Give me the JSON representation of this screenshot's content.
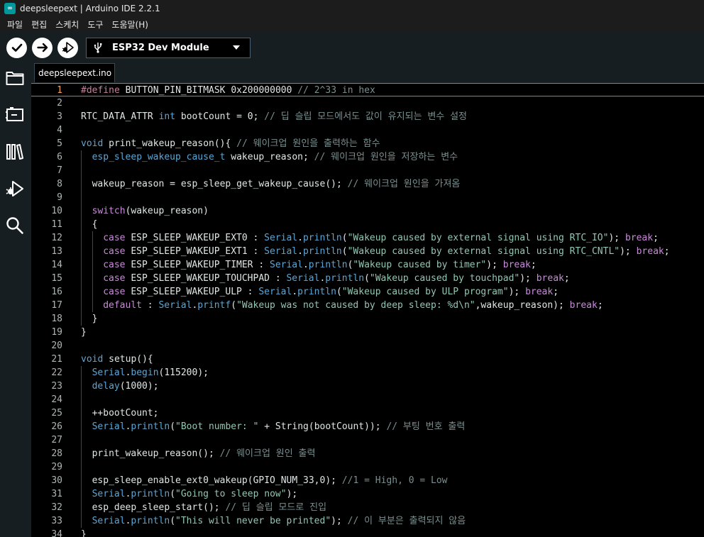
{
  "window": {
    "title": "deepsleepext | Arduino IDE 2.2.1",
    "app_logo_glyph": "∞"
  },
  "menu": [
    "파일",
    "편집",
    "스케치",
    "도구",
    "도움말(H)"
  ],
  "toolbar": {
    "verify_icon": "check-icon",
    "upload_icon": "arrow-right-icon",
    "debug_icon": "debug-icon",
    "board_icon": "usb-icon",
    "board_name": "ESP32 Dev Module"
  },
  "sidebar": {
    "items": [
      {
        "name": "sketchbook",
        "icon": "folder-icon"
      },
      {
        "name": "boards-manager",
        "icon": "board-icon"
      },
      {
        "name": "library-manager",
        "icon": "library-icon"
      },
      {
        "name": "debug",
        "icon": "debug-icon"
      },
      {
        "name": "search",
        "icon": "search-icon"
      }
    ]
  },
  "tabs": [
    {
      "label": "deepsleepext.ino",
      "active": true
    }
  ],
  "editor": {
    "current_line": 1,
    "lines": [
      {
        "n": "1",
        "indent": 0,
        "tokens": [
          [
            "pre",
            "#define"
          ],
          [
            "p",
            " BUTTON_PIN_BITMASK 0x200000000 "
          ],
          [
            "com",
            "// 2^33 in hex"
          ]
        ]
      },
      {
        "n": "2",
        "indent": 0,
        "tokens": []
      },
      {
        "n": "3",
        "indent": 0,
        "tokens": [
          [
            "p",
            "RTC_DATA_ATTR "
          ],
          [
            "type",
            "int"
          ],
          [
            "p",
            " bootCount = 0; "
          ],
          [
            "com",
            "// 딥 슬립 모드에서도 값이 유지되는 변수 설정"
          ]
        ]
      },
      {
        "n": "4",
        "indent": 0,
        "tokens": []
      },
      {
        "n": "5",
        "indent": 0,
        "tokens": [
          [
            "type",
            "void"
          ],
          [
            "p",
            " print_wakeup_reason(){ "
          ],
          [
            "com",
            "// 웨이크업 원인을 출력하는 함수"
          ]
        ]
      },
      {
        "n": "6",
        "indent": 1,
        "tokens": [
          [
            "type",
            "esp_sleep_wakeup_cause_t"
          ],
          [
            "p",
            " wakeup_reason; "
          ],
          [
            "com",
            "// 웨이크업 원인을 저장하는 변수"
          ]
        ]
      },
      {
        "n": "7",
        "indent": 1,
        "tokens": []
      },
      {
        "n": "8",
        "indent": 1,
        "tokens": [
          [
            "p",
            "wakeup_reason = esp_sleep_get_wakeup_cause(); "
          ],
          [
            "com",
            "// 웨이크업 원인을 가져옴"
          ]
        ]
      },
      {
        "n": "9",
        "indent": 1,
        "tokens": []
      },
      {
        "n": "10",
        "indent": 1,
        "tokens": [
          [
            "kw",
            "switch"
          ],
          [
            "p",
            "(wakeup_reason)"
          ]
        ]
      },
      {
        "n": "11",
        "indent": 1,
        "tokens": [
          [
            "p",
            "{"
          ]
        ]
      },
      {
        "n": "12",
        "indent": 2,
        "tokens": [
          [
            "kw",
            "case"
          ],
          [
            "p",
            " ESP_SLEEP_WAKEUP_EXT0 : "
          ],
          [
            "obj",
            "Serial"
          ],
          [
            "p",
            "."
          ],
          [
            "obj",
            "println"
          ],
          [
            "p",
            "("
          ],
          [
            "str",
            "\"Wakeup caused by external signal using RTC_IO\""
          ],
          [
            "p",
            "); "
          ],
          [
            "kw",
            "break"
          ],
          [
            "p",
            ";"
          ]
        ]
      },
      {
        "n": "13",
        "indent": 2,
        "tokens": [
          [
            "kw",
            "case"
          ],
          [
            "p",
            " ESP_SLEEP_WAKEUP_EXT1 : "
          ],
          [
            "obj",
            "Serial"
          ],
          [
            "p",
            "."
          ],
          [
            "obj",
            "println"
          ],
          [
            "p",
            "("
          ],
          [
            "str",
            "\"Wakeup caused by external signal using RTC_CNTL\""
          ],
          [
            "p",
            "); "
          ],
          [
            "kw",
            "break"
          ],
          [
            "p",
            ";"
          ]
        ]
      },
      {
        "n": "14",
        "indent": 2,
        "tokens": [
          [
            "kw",
            "case"
          ],
          [
            "p",
            " ESP_SLEEP_WAKEUP_TIMER : "
          ],
          [
            "obj",
            "Serial"
          ],
          [
            "p",
            "."
          ],
          [
            "obj",
            "println"
          ],
          [
            "p",
            "("
          ],
          [
            "str",
            "\"Wakeup caused by timer\""
          ],
          [
            "p",
            "); "
          ],
          [
            "kw",
            "break"
          ],
          [
            "p",
            ";"
          ]
        ]
      },
      {
        "n": "15",
        "indent": 2,
        "tokens": [
          [
            "kw",
            "case"
          ],
          [
            "p",
            " ESP_SLEEP_WAKEUP_TOUCHPAD : "
          ],
          [
            "obj",
            "Serial"
          ],
          [
            "p",
            "."
          ],
          [
            "obj",
            "println"
          ],
          [
            "p",
            "("
          ],
          [
            "str",
            "\"Wakeup caused by touchpad\""
          ],
          [
            "p",
            "); "
          ],
          [
            "kw",
            "break"
          ],
          [
            "p",
            ";"
          ]
        ]
      },
      {
        "n": "16",
        "indent": 2,
        "tokens": [
          [
            "kw",
            "case"
          ],
          [
            "p",
            " ESP_SLEEP_WAKEUP_ULP : "
          ],
          [
            "obj",
            "Serial"
          ],
          [
            "p",
            "."
          ],
          [
            "obj",
            "println"
          ],
          [
            "p",
            "("
          ],
          [
            "str",
            "\"Wakeup caused by ULP program\""
          ],
          [
            "p",
            "); "
          ],
          [
            "kw",
            "break"
          ],
          [
            "p",
            ";"
          ]
        ]
      },
      {
        "n": "17",
        "indent": 2,
        "tokens": [
          [
            "kw",
            "default"
          ],
          [
            "p",
            " : "
          ],
          [
            "obj",
            "Serial"
          ],
          [
            "p",
            "."
          ],
          [
            "obj",
            "printf"
          ],
          [
            "p",
            "("
          ],
          [
            "str",
            "\"Wakeup was not caused by deep sleep: %d\\n\""
          ],
          [
            "p",
            ",wakeup_reason); "
          ],
          [
            "kw",
            "break"
          ],
          [
            "p",
            ";"
          ]
        ]
      },
      {
        "n": "18",
        "indent": 1,
        "tokens": [
          [
            "p",
            "}"
          ]
        ]
      },
      {
        "n": "19",
        "indent": 0,
        "tokens": [
          [
            "p",
            "}"
          ]
        ]
      },
      {
        "n": "20",
        "indent": 0,
        "tokens": []
      },
      {
        "n": "21",
        "indent": 0,
        "tokens": [
          [
            "type",
            "void"
          ],
          [
            "p",
            " setup(){"
          ]
        ]
      },
      {
        "n": "22",
        "indent": 1,
        "tokens": [
          [
            "obj",
            "Serial"
          ],
          [
            "p",
            "."
          ],
          [
            "obj",
            "begin"
          ],
          [
            "p",
            "(115200);"
          ]
        ]
      },
      {
        "n": "23",
        "indent": 1,
        "tokens": [
          [
            "obj",
            "delay"
          ],
          [
            "p",
            "(1000);"
          ]
        ]
      },
      {
        "n": "24",
        "indent": 1,
        "tokens": []
      },
      {
        "n": "25",
        "indent": 1,
        "tokens": [
          [
            "p",
            "++bootCount;"
          ]
        ]
      },
      {
        "n": "26",
        "indent": 1,
        "tokens": [
          [
            "obj",
            "Serial"
          ],
          [
            "p",
            "."
          ],
          [
            "obj",
            "println"
          ],
          [
            "p",
            "("
          ],
          [
            "str",
            "\"Boot number: \""
          ],
          [
            "p",
            " + "
          ],
          [
            "p",
            "String(bootCount)); "
          ],
          [
            "com",
            "// 부팅 번호 출력"
          ]
        ]
      },
      {
        "n": "27",
        "indent": 1,
        "tokens": []
      },
      {
        "n": "28",
        "indent": 1,
        "tokens": [
          [
            "p",
            "print_wakeup_reason(); "
          ],
          [
            "com",
            "// 웨이크업 원인 출력"
          ]
        ]
      },
      {
        "n": "29",
        "indent": 1,
        "tokens": []
      },
      {
        "n": "30",
        "indent": 1,
        "tokens": [
          [
            "p",
            "esp_sleep_enable_ext0_wakeup(GPIO_NUM_33,0); "
          ],
          [
            "com",
            "//1 = High, 0 = Low"
          ]
        ]
      },
      {
        "n": "31",
        "indent": 1,
        "tokens": [
          [
            "obj",
            "Serial"
          ],
          [
            "p",
            "."
          ],
          [
            "obj",
            "println"
          ],
          [
            "p",
            "("
          ],
          [
            "str",
            "\"Going to sleep now\""
          ],
          [
            "p",
            ");"
          ]
        ]
      },
      {
        "n": "32",
        "indent": 1,
        "tokens": [
          [
            "p",
            "esp_deep_sleep_start(); "
          ],
          [
            "com",
            "// 딥 슬립 모드로 진입"
          ]
        ]
      },
      {
        "n": "33",
        "indent": 1,
        "tokens": [
          [
            "obj",
            "Serial"
          ],
          [
            "p",
            "."
          ],
          [
            "obj",
            "println"
          ],
          [
            "p",
            "("
          ],
          [
            "str",
            "\"This will never be printed\""
          ],
          [
            "p",
            "); "
          ],
          [
            "com",
            "// 이 부분은 출력되지 않음"
          ]
        ]
      },
      {
        "n": "34",
        "indent": 0,
        "tokens": [
          [
            "p",
            "}"
          ]
        ]
      }
    ]
  }
}
